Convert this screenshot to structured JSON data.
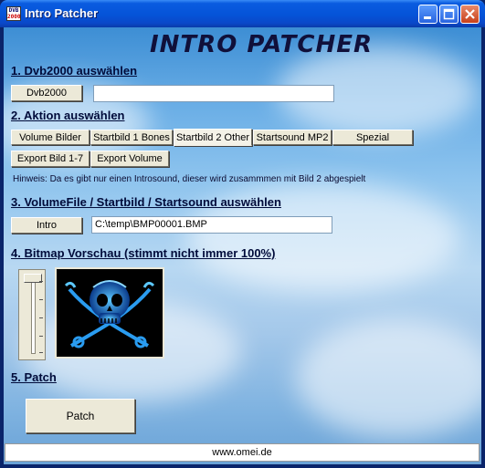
{
  "window": {
    "title": "Intro Patcher",
    "app_icon_line1": "DVB",
    "app_icon_line2": "2000"
  },
  "header": {
    "logo_text": "INTRO PATCHER"
  },
  "section1": {
    "title": "1. Dvb2000 auswählen",
    "button": "Dvb2000",
    "path_value": ""
  },
  "section2": {
    "title": "2. Aktion auswählen",
    "tabs": [
      "Volume Bilder",
      "Startbild 1 Bones",
      "Startbild 2 Other",
      "Startsound MP2",
      "Spezial"
    ],
    "active_tab": "Startbild 2 Other",
    "export_buttons": [
      "Export Bild 1-7",
      "Export Volume"
    ],
    "hint": "Hinweis: Da es gibt nur einen Introsound, dieser wird zusammmen mit Bild 2 abgespielt"
  },
  "section3": {
    "title": "3. VolumeFile / Startbild / Startsound auswählen",
    "button": "Intro",
    "path_value": "C:\\temp\\BMP00001.BMP"
  },
  "section4": {
    "title": "4. Bitmap Vorschau (stimmt nicht immer 100%)"
  },
  "section5": {
    "title": "5. Patch",
    "button": "Patch"
  },
  "status": {
    "text": "www.omei.de"
  },
  "colors": {
    "titlebar": "#0553d8",
    "section_text": "#000b3a",
    "preview_glow": "#2aa8ff"
  }
}
